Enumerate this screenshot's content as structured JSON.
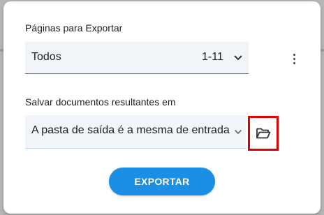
{
  "dialog": {
    "pages_label": "Páginas para Exportar",
    "pages_select": {
      "value": "Todos",
      "range": "1-11"
    },
    "save_label": "Salvar documentos resultantes em",
    "destination_select": {
      "value": "A pasta de saída é a mesma de entrada"
    },
    "export_button": "EXPORTAR"
  },
  "icons": {
    "more": "more-vert-icon",
    "folder": "folder-open-icon",
    "chevron": "chevron-down-icon"
  },
  "colors": {
    "accent": "#1a8fe3",
    "highlight_box": "#e10000",
    "select_bg": "#f1f5fa"
  }
}
